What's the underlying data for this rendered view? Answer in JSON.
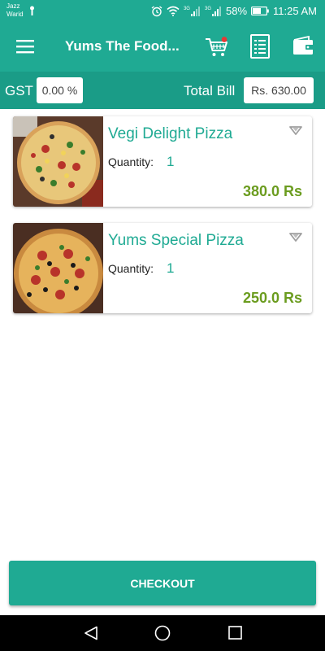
{
  "status_bar": {
    "carrier_line1": "Jazz",
    "carrier_line2": "Warid",
    "network1": "3G",
    "network2": "3G",
    "battery": "58%",
    "time": "11:25 AM"
  },
  "app_bar": {
    "title": "Yums The Food..."
  },
  "bill": {
    "gst_label": "GST",
    "gst_value": "0.00 %",
    "total_label": "Total Bill",
    "total_value": "Rs. 630.00"
  },
  "cart": {
    "items": [
      {
        "name": "Vegi Delight Pizza",
        "quantity_label": "Quantity:",
        "quantity": "1",
        "price": "380.0 Rs"
      },
      {
        "name": "Yums Special Pizza",
        "quantity_label": "Quantity:",
        "quantity": "1",
        "price": "250.0 Rs"
      }
    ]
  },
  "checkout_label": "CHECKOUT",
  "colors": {
    "primary": "#1faa93",
    "primary_dark": "#1a9c87",
    "price": "#6b9c1f",
    "cart_dot": "#e53935"
  },
  "icons": [
    "menu-icon",
    "cart-icon",
    "bill-icon",
    "wallet-icon",
    "dropdown-icon",
    "back-icon",
    "home-icon",
    "recents-icon"
  ]
}
